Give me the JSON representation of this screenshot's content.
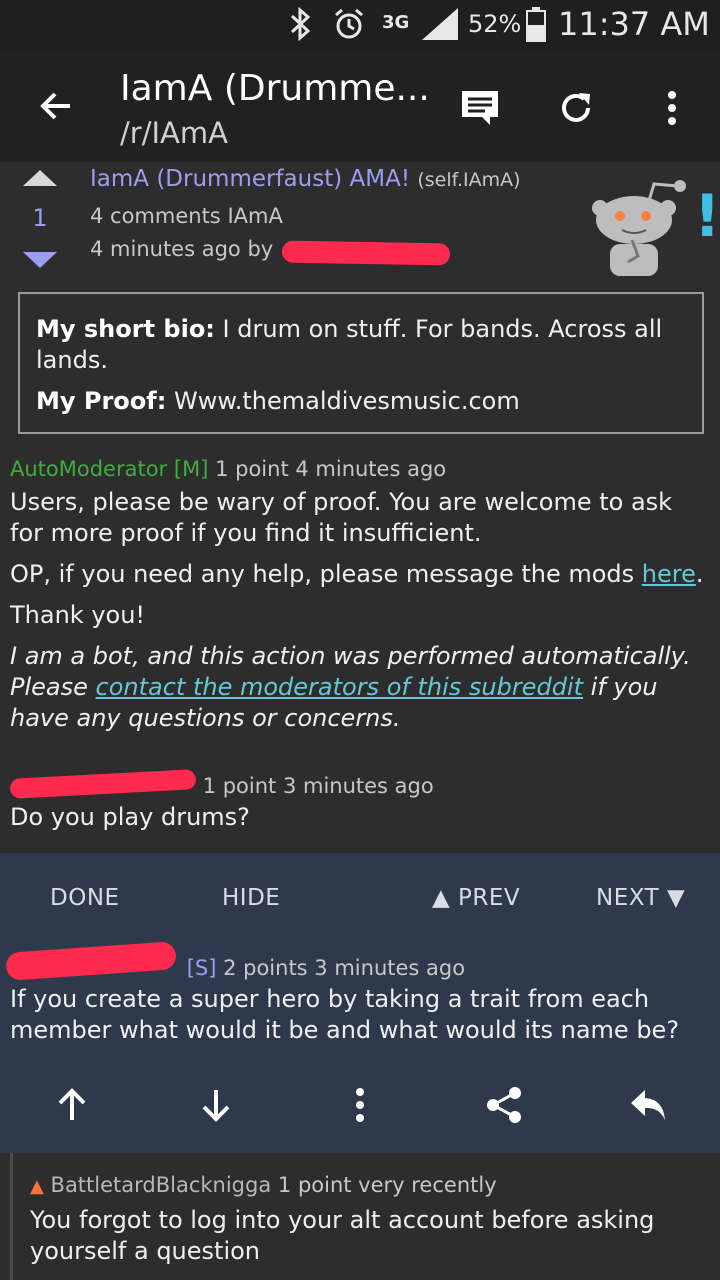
{
  "status": {
    "signal": "3G",
    "battery": "52%",
    "time": "11:37 AM"
  },
  "appbar": {
    "title": "IamA (Drumme...",
    "subreddit": "/r/IAmA"
  },
  "post": {
    "score": "1",
    "title": "IamA (Drummerfaust) AMA!",
    "domain": "(self.IAmA)",
    "comments": "4 comments",
    "sub": "IAmA",
    "time": "4 minutes ago",
    "by": "by",
    "selftext": {
      "bio_label": "My short bio:",
      "bio": "I drum on stuff. For bands. Across all lands.",
      "proof_label": "My Proof:",
      "proof": "Www.themaldivesmusic.com"
    }
  },
  "comments": {
    "automod": {
      "author": "AutoModerator",
      "flair": "[M]",
      "meta": "1 point 4 minutes ago",
      "p1": "Users, please be wary of proof. You are welcome to ask for more proof if you find it insufficient.",
      "p2_pre": "OP, if you need any help, please message the mods ",
      "p2_link": "here",
      "p2_post": ".",
      "p3": "Thank you!",
      "p4_a": "I am a bot, and this action was performed automatically. Please ",
      "p4_link": "contact the moderators of this subreddit",
      "p4_b": " if you have any questions or concerns."
    },
    "second": {
      "meta": "1 point 3 minutes ago",
      "body": "Do you play drums?"
    },
    "selected": {
      "flair": "[S]",
      "meta": "2 points 3 minutes ago",
      "body": "If you create a super hero by taking a trait from each member what would it be and what would its name be?"
    },
    "reply": {
      "author": "BattletardBlacknigga",
      "meta": "1 point very recently",
      "body": "You forgot to log into your alt account before asking yourself a question"
    }
  },
  "actions": {
    "done": "DONE",
    "hide": "HIDE",
    "prev": "▲ PREV",
    "next": "NEXT ▼"
  },
  "colors": {
    "accent": "#9e9ef0",
    "mod_green": "#3fae3f",
    "link": "#64c8d8",
    "panel": "#2e3a4c",
    "redaction": "#ff2b4f"
  },
  "icons": [
    "bluetooth-icon",
    "alarm-icon",
    "signal-icon",
    "battery-icon",
    "back-arrow-icon",
    "comment-icon",
    "refresh-icon",
    "overflow-menu-icon",
    "upvote-icon",
    "downvote-icon",
    "snoo-icon",
    "upvote-arrow-icon",
    "downvote-arrow-icon",
    "more-vert-icon",
    "share-icon",
    "reply-icon"
  ]
}
